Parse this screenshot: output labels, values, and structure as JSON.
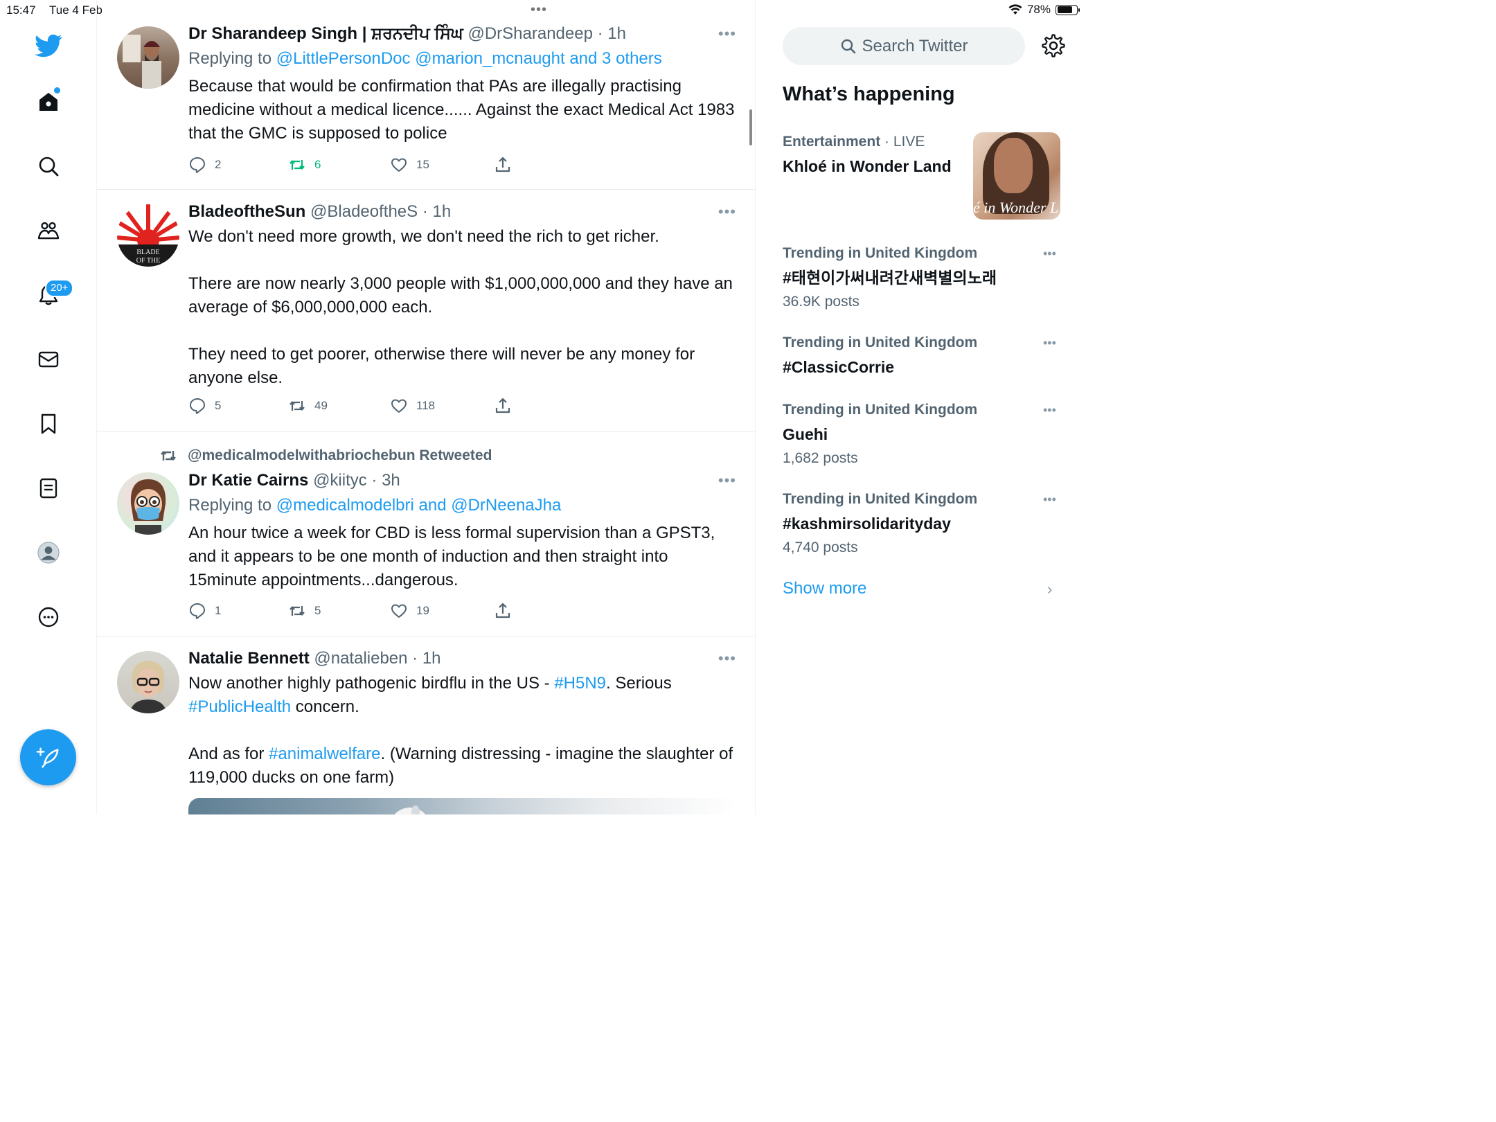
{
  "status_bar": {
    "time": "15:47",
    "date": "Tue 4 Feb",
    "battery": "78%",
    "battery_level": 0.78
  },
  "nav": {
    "notifications_badge": "20+",
    "icons": [
      "twitter-logo",
      "home-icon",
      "search-icon",
      "communities-icon",
      "notifications-icon",
      "messages-icon",
      "bookmarks-icon",
      "lists-icon",
      "profile-icon",
      "more-icon",
      "compose-icon"
    ]
  },
  "tweets": [
    {
      "name": "Dr Sharandeep Singh | ਸ਼ਰਨਦੀਪ ਸਿੰਘ",
      "handle": "@DrSharandeep · 1h",
      "reply_prefix": "Replying to ",
      "reply_to": "@LittlePersonDoc @marion_mcnaught and 3 others",
      "text": "Because that would be confirmation that PAs are illegally practising medicine without a medical licence...... Against the exact Medical Act 1983 that the GMC is supposed to police",
      "replies": "2",
      "retweets": "6",
      "likes": "15"
    },
    {
      "name": "BladeoftheSun",
      "handle": "@BladeoftheS · 1h",
      "text_1": "We don't need more growth, we don't need the rich to get richer.",
      "text_2": "There are now nearly 3,000 people with $1,000,000,000 and they have an average of $6,000,000,000 each.",
      "text_3": "They need to get poorer, otherwise there will never be any money for anyone else.",
      "avatar_text": "BLADE OF THE SUN",
      "replies": "5",
      "retweets": "49",
      "likes": "118"
    },
    {
      "retweeted_by": "@medicalmodelwithabriochebun Retweeted",
      "name": "Dr Katie Cairns",
      "handle": "@kiityc · 3h",
      "reply_prefix": "Replying to ",
      "reply_to": "@medicalmodelbri and @DrNeenaJha",
      "text": "An hour twice a week for CBD is less formal supervision than a GPST3, and it appears to be one month of induction and then straight into 15minute appointments...dangerous.",
      "replies": "1",
      "retweets": "5",
      "likes": "19"
    },
    {
      "name": "Natalie Bennett",
      "handle": "@natalieben · 1h",
      "text_1a": "Now another highly pathogenic birdflu in the US - ",
      "tag_1": "#H5N9",
      "text_1b": ". Serious ",
      "tag_2": "#PublicHealth",
      "text_1c": " concern.",
      "text_2a": "And as for ",
      "tag_3": "#animalwelfare",
      "text_2b": ". (Warning distressing - imagine the slaughter of 119,000 ducks on one farm)"
    }
  ],
  "sidebar": {
    "search_placeholder": "Search Twitter",
    "section_title": "What’s happening",
    "trends": [
      {
        "category": "Entertainment",
        "sep": " · ",
        "live": "LIVE",
        "title": "Khloé in Wonder Land",
        "image_text": "é in Wonder L"
      },
      {
        "category": "Trending in United Kingdom",
        "title": "#태현이가써내려간새벽별의노래",
        "count": "36.9K posts"
      },
      {
        "category": "Trending in United Kingdom",
        "title": "#ClassicCorrie"
      },
      {
        "category": "Trending in United Kingdom",
        "title": "Guehi",
        "count": "1,682 posts"
      },
      {
        "category": "Trending in United Kingdom",
        "title": "#kashmirsolidarityday",
        "count": "4,740 posts"
      }
    ],
    "show_more": "Show more"
  },
  "colors": {
    "accent": "#1d9bf0",
    "retweet_active": "#00ba7c",
    "muted": "#536471"
  }
}
